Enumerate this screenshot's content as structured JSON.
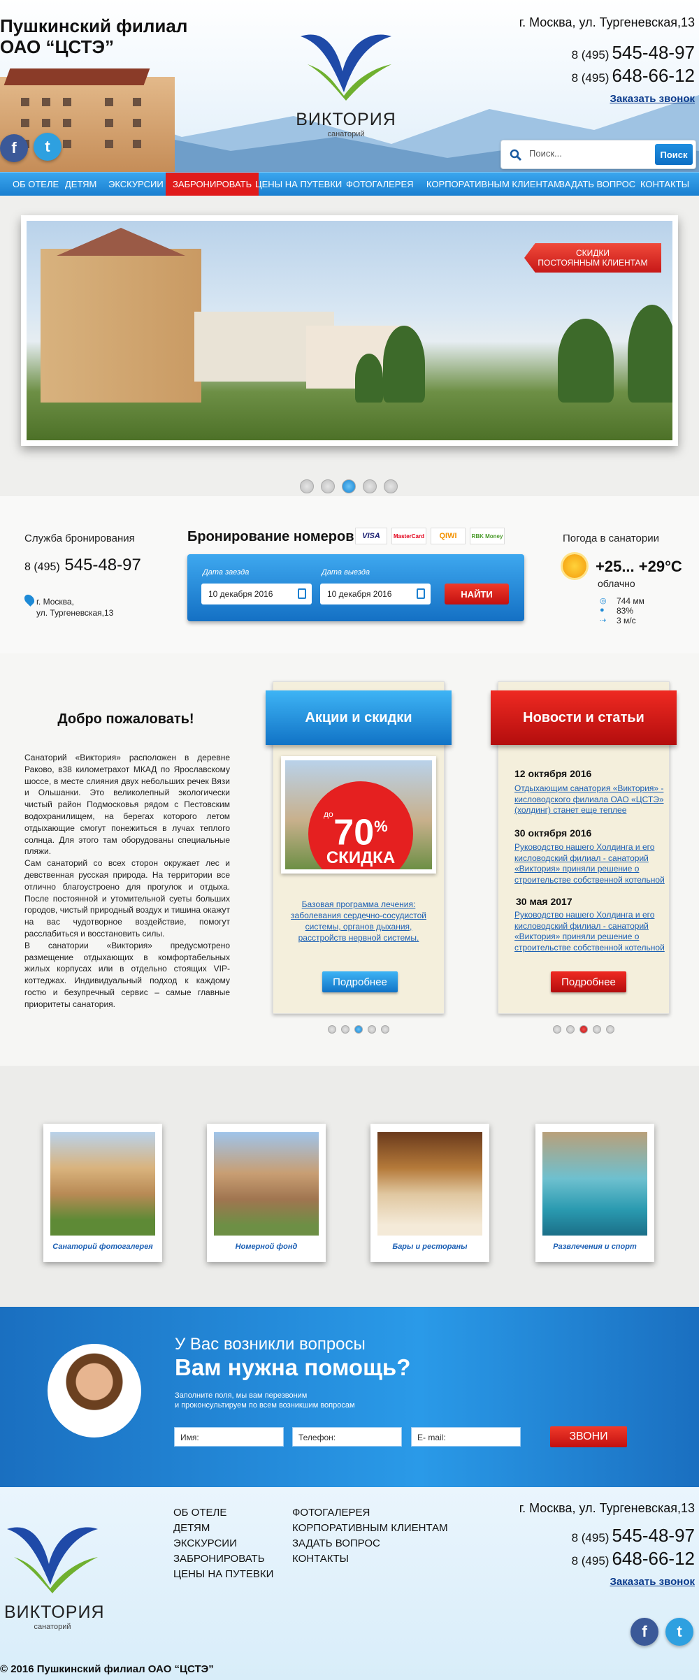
{
  "header": {
    "site_title_line1": "Пушкинский филиал",
    "site_title_line2": "ОАО “ЦСТЭ”",
    "logo_name": "ВИКТОРИЯ",
    "logo_sub": "санаторий",
    "address": "г. Москва, ул. Тургеневская,13",
    "phone1_code": "8 (495)",
    "phone1": "545-48-97",
    "phone2_code": "8 (495)",
    "phone2": "648-66-12",
    "callback": "Заказать звонок",
    "search_placeholder": "Поиск...",
    "search_button": "Поиск"
  },
  "nav": {
    "items": [
      "Об отеле",
      "Детям",
      "Экскурсии",
      "Забронировать",
      "Цены на путевки",
      "Фотогалерея",
      "Корпоративным клиентам",
      "Задать вопрос",
      "Контакты"
    ],
    "active_index": 3
  },
  "slider": {
    "ribbon_line1": "Скидки",
    "ribbon_line2": "постоянным клиентам",
    "dots": 5,
    "active_dot": 2
  },
  "booking": {
    "service_title": "Служба бронирования",
    "service_phone_code": "8 (495)",
    "service_phone": "545-48-97",
    "address_line1": "г. Москва,",
    "address_line2": "ул. Тургеневская,13",
    "title": "Бронирование номеров",
    "payments": [
      "VISA",
      "MasterCard",
      "QIWI",
      "RBK Money"
    ],
    "checkin_label": "Дата заезда",
    "checkin_value": "10 декабря 2016",
    "checkout_label": "Дата выезда",
    "checkout_value": "10 декабря 2016",
    "find_button": "НАЙТИ"
  },
  "weather": {
    "title": "Погода в санатории",
    "temp": "+25... +29°С",
    "condition": "облачно",
    "pressure": "744 мм",
    "humidity": "83%",
    "wind": "3 м/с"
  },
  "welcome": {
    "title": "Добро пожаловать!",
    "p1": "Санаторий «Виктория» расположен в деревне Раково, в38 километрахот МКАД по Ярославскому шоссе, в месте слияния двух небольших речек Вязи и Ольшанки. Это великолепный экологически чистый район Подмосковья рядом с Пестовским водохранилищем, на берегах которого летом отдыхающие смогут понежиться в лучах теплого солнца. Для этого там оборудованы специальные пляжи.",
    "p2": "Сам санаторий со всех сторон окружает лес и девственная русская природа. На территории все отлично благоустроено для прогулок и отдыха. После постоянной и утомительной суеты больших городов, чистый природный воздух и тишина окажут на вас чудотворное воздействие, помогут расслабиться и восстановить силы.",
    "p3": "В санатории «Виктория» предусмотрено размещение отдыхающих в комфортабельных жилых корпусах или в отдельно стоящих VIP-коттеджах. Индивидуальный подход к каждому гостю и безупречный сервис – самые главные приоритеты санатория."
  },
  "promo": {
    "title": "Акции и скидки",
    "badge_prefix": "до",
    "badge_value": "70",
    "badge_unit": "%",
    "badge_word": "СКИДКА",
    "link": "Базовая программа лечения: заболевания сердечно-сосудистой системы, органов дыхания, расстройств нервной системы.",
    "button": "Подробнее",
    "dots": 5,
    "active_dot": 2
  },
  "news": {
    "title": "Новости и статьи",
    "items": [
      {
        "date": "12 октября 2016",
        "text": "Отдыхающим санатория «Виктория» - кисловодского филиала ОАО «ЦСТЭ» (холдинг) станет еще теплее"
      },
      {
        "date": "30 октября 2016",
        "text": "Руководство нашего Холдинга и его кисловодский филиал - санаторий «Виктория» приняли решение о строительстве собственной котельной"
      },
      {
        "date": "30 мая 2017",
        "text": "Руководство нашего Холдинга и его кисловодский филиал - санаторий «Виктория» приняли решение о строительстве собственной котельной"
      }
    ],
    "button": "Подробнее",
    "dots": 5,
    "active_dot": 2
  },
  "gallery": {
    "items": [
      "Санаторий фотогалерея",
      "Номерной фонд",
      "Бары и рестораны",
      "Развлечения и спорт"
    ]
  },
  "help": {
    "question": "У Вас возникли вопросы",
    "headline": "Вам нужна помощь?",
    "note_line1": "Заполните поля, мы вам перезвоним",
    "note_line2": "и проконсультируем по всем возникшим вопросам",
    "name_placeholder": "Имя:",
    "phone_placeholder": "Телефон:",
    "email_placeholder": "E- mail:",
    "button": "ЗВОНИ"
  },
  "footer": {
    "col1": [
      "Об отеле",
      "Детям",
      "Экскурсии",
      "Забронировать",
      "Цены на путевки"
    ],
    "col2": [
      "Фотогалерея",
      "Корпоративным клиентам",
      "Задать вопрос",
      "Контакты"
    ],
    "copyright": "© 2016 Пушкинский филиал ОАО “ЦСТЭ”"
  }
}
